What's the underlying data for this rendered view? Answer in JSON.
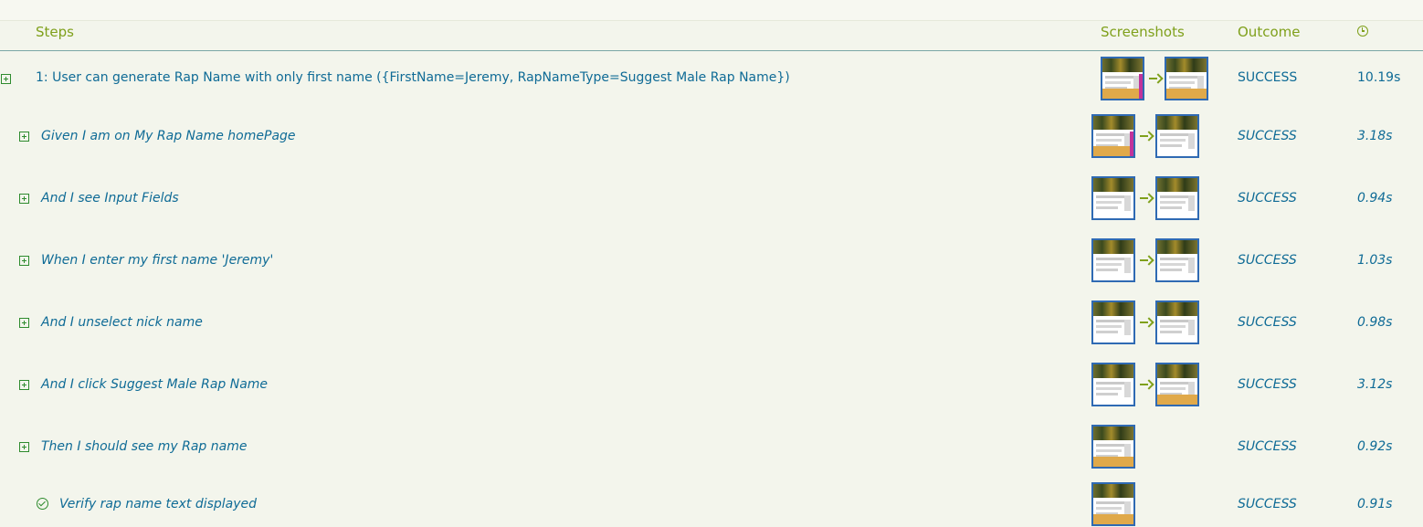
{
  "header": {
    "steps": "Steps",
    "screenshots": "Screenshots",
    "outcome": "Outcome",
    "duration_icon": "clock-icon"
  },
  "scenario": {
    "label": "1: User can generate Rap Name with only first name ({FirstName=Jeremy, RapNameType=Suggest Male Rap Name})",
    "outcome": "SUCCESS",
    "duration": "10.19s"
  },
  "steps": [
    {
      "label": "Given I am on My Rap Name homePage",
      "outcome": "SUCCESS",
      "duration": "3.18s",
      "icon": "expand-icon"
    },
    {
      "label": "And I see Input Fields",
      "outcome": "SUCCESS",
      "duration": "0.94s",
      "icon": "expand-icon"
    },
    {
      "label": "When I enter my first name 'Jeremy'",
      "outcome": "SUCCESS",
      "duration": "1.03s",
      "icon": "expand-icon"
    },
    {
      "label": "And I unselect nick name",
      "outcome": "SUCCESS",
      "duration": "0.98s",
      "icon": "expand-icon"
    },
    {
      "label": "And I click Suggest Male Rap Name",
      "outcome": "SUCCESS",
      "duration": "3.12s",
      "icon": "expand-icon"
    },
    {
      "label": "Then I should see my Rap name",
      "outcome": "SUCCESS",
      "duration": "0.92s",
      "icon": "expand-icon"
    },
    {
      "label": "Verify rap name text displayed",
      "outcome": "SUCCESS",
      "duration": "0.91s",
      "icon": "check-circle-icon"
    }
  ]
}
